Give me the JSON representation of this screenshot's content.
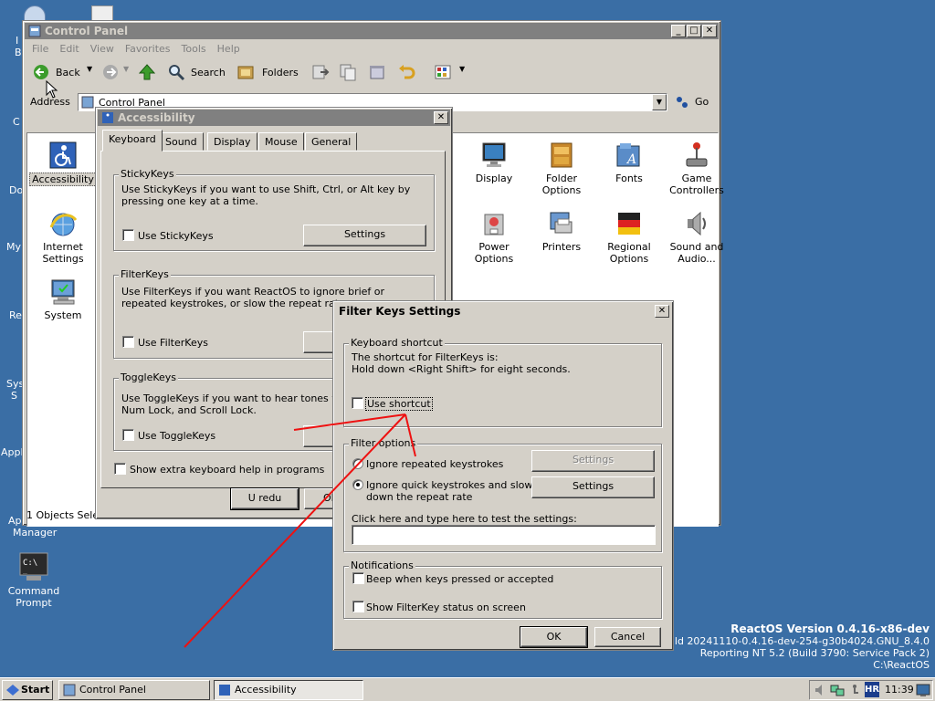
{
  "desktop": {
    "left_fragments": [
      "I",
      "B",
      "C",
      "Do",
      "My",
      "Re",
      "Sys",
      "S",
      "Appl",
      "Ap",
      "Manager"
    ],
    "icons": [
      {
        "label": "Command Prompt",
        "icon": "terminal-icon"
      }
    ],
    "build": {
      "line1": "ReactOS Version 0.4.16-x86-dev",
      "line2": "Build 20241110-0.4.16-dev-254-g30b4024.GNU_8.4.0",
      "line3": "Reporting NT 5.2 (Build 3790: Service Pack 2)",
      "line4": "C:\\ReactOS"
    }
  },
  "control_panel": {
    "title": "Control Panel",
    "menu": [
      "File",
      "Edit",
      "View",
      "Favorites",
      "Tools",
      "Help"
    ],
    "toolbar": {
      "back": "Back",
      "search": "Search",
      "folders": "Folders"
    },
    "address": {
      "label": "Address",
      "value": "Control Panel",
      "go": "Go"
    },
    "left_items": [
      {
        "label": "Accessibility",
        "icon": "accessibility-icon"
      },
      {
        "label": "Internet Settings",
        "icon": "internet-settings-icon"
      },
      {
        "label": "System",
        "icon": "system-icon"
      }
    ],
    "items": [
      {
        "label": "Display",
        "icon": "display-icon"
      },
      {
        "label": "Folder Options",
        "icon": "folder-options-icon"
      },
      {
        "label": "Fonts",
        "icon": "fonts-icon"
      },
      {
        "label": "Game Controllers",
        "icon": "game-controllers-icon"
      },
      {
        "label": "Power Options",
        "icon": "power-options-icon"
      },
      {
        "label": "Printers",
        "icon": "printers-icon"
      },
      {
        "label": "Regional Options",
        "icon": "regional-options-icon"
      },
      {
        "label": "Sound and Audio...",
        "icon": "sound-audio-icon"
      }
    ],
    "status": "1 Objects Selec"
  },
  "accessibility": {
    "title": "Accessibility",
    "tabs": [
      "Keyboard",
      "Sound",
      "Display",
      "Mouse",
      "General"
    ],
    "selected_tab": "Keyboard",
    "stickykeys": {
      "title": "StickyKeys",
      "description": "Use StickyKeys if you want to use Shift, Ctrl, or Alt key by pressing one key at a time.",
      "checkbox": "Use StickyKeys",
      "settings": "Settings"
    },
    "filterkeys": {
      "title": "FilterKeys",
      "description": "Use FilterKeys if you want ReactOS to ignore brief or repeated keystrokes, or slow the repeat rate.",
      "checkbox": "Use FilterKeys"
    },
    "togglekeys": {
      "title": "ToggleKeys",
      "description_line1": "Use ToggleKeys if you want to hear tones when",
      "description_line2": "Num Lock, and Scroll Lock.",
      "checkbox": "Use ToggleKeys"
    },
    "extra_help": "Show extra keyboard help in programs",
    "ok_button": "U redu",
    "cancel_partial": "Ol"
  },
  "filter_keys": {
    "title": "Filter Keys Settings",
    "shortcut": {
      "title": "Keyboard shortcut",
      "line1": "The shortcut for FilterKeys is:",
      "line2": "Hold down <Right Shift> for eight seconds.",
      "checkbox": "Use shortcut"
    },
    "filter_options": {
      "title": "Filter options",
      "radio1": "Ignore repeated keystrokes",
      "radio2_line1": "Ignore quick keystrokes and slow",
      "radio2_line2": "down the repeat rate",
      "settings1": "Settings",
      "settings2": "Settings",
      "test_label": "Click here and type here to test the settings:",
      "test_value": ""
    },
    "notifications": {
      "title": "Notifications",
      "beep": "Beep when keys pressed or accepted",
      "status": "Show FilterKey status on screen"
    },
    "ok": "OK",
    "cancel": "Cancel"
  },
  "taskbar": {
    "start": "Start",
    "tasks": [
      "Control Panel",
      "Accessibility"
    ],
    "lang": "HR",
    "time": "11:39"
  }
}
